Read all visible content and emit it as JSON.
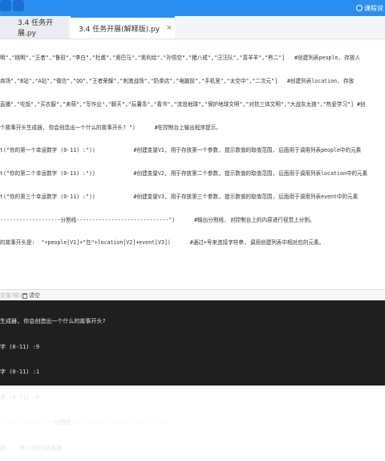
{
  "topbar": {
    "course_label": "课程说"
  },
  "tabs": [
    {
      "label": "3.4 任务开展.py"
    },
    {
      "label": "3.4 任务开展(解释版).py",
      "close": "×"
    }
  ],
  "code_lines": [
    "明\",\"桃明\",\"王者\",\"鲁班\",\"李白\",\"杜甫\",\"奥巴马\",\"奥利给\",\"孙悟空\",\"猪八戒\",\"汪汪队\",\"喜羊羊\",\"熊二\"]   #创建列表people, 存放人",
    "商场\",\"B站\",\"A站\",\"微信\",\"QQ\",\"王者荣耀\",\"刺激战场\",\"奶茶店\",\"电脑前\",\"手机里\",\"太空中\",\"二次元\"]   #创建列表location, 存放",
    "直播\",\"吃饭\",\"买衣服\",\"卖萌\",\"写作业\",\"聊天\",\"玩薯条\",\"看书\",\"流浪地球\",\"保护地球文明\",\"对抗三体文明\",\"大战灰太狼\",\"热爱学习\"] #创",
    "个故事开头生成器, 你会创造出一个什么的故事开头? \")      #在控制台上输出程序提示。",
    "t(\"你的第一个幸运数字 (0-11) :\"))            #创建变量V1, 用于存放第一个参数, 提示数值的取值范围, 后面用于调用列表people中的元素",
    "t(\"你的第二个幸运数字 (0-11) :\"))            #创建变量V2, 用于存放第二个参数, 提示数值的取值范围, 后面用于调用列表location中的元素",
    "t(\"你的第三个幸运数字 (0-11) :\"))            #创建变量V3, 用于存放第三个参数, 提示数值的取值范围, 后面用于调用列表event中的元素",
    "-------------------分割线-----------------------------\")      #输出分割线, 对控制台上的内容进行视觉上分割。",
    "的故事开头是:  \"+people[V1]+\"在\"+location[V2]+event[V3])      #通过+号来连接字符串, 调用创建列表中相对应的元素。"
  ],
  "console_bar": {
    "label_left": "变量/输出",
    "clear_label": "清空"
  },
  "console_lines": [
    "生成器, 你会创造出一个什么的故事开头?",
    "字 (0-11) :9",
    "字 (0-11) :1",
    "字 (0-11) :0",
    "----------------分割线------------------------------",
    "是:   猪八戒在B站直播"
  ]
}
